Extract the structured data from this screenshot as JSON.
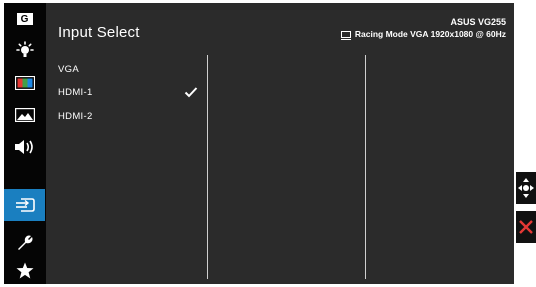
{
  "header": {
    "title": "Input Select",
    "model": "ASUS VG255",
    "mode_info": "Racing Mode VGA 1920x1080 @ 60Hz"
  },
  "sidebar": {
    "items": [
      {
        "icon": "gaming-g-icon"
      },
      {
        "icon": "brightness-icon"
      },
      {
        "icon": "color-icon"
      },
      {
        "icon": "image-icon"
      },
      {
        "icon": "sound-icon"
      },
      {
        "icon": "input-select-icon",
        "active": true
      },
      {
        "icon": "system-setup-icon"
      },
      {
        "icon": "favorite-star-icon"
      }
    ],
    "g_label": "G"
  },
  "options": [
    {
      "label": "VGA",
      "checked": false
    },
    {
      "label": "HDMI-1",
      "checked": true
    },
    {
      "label": "HDMI-2",
      "checked": false
    }
  ],
  "controls": [
    {
      "icon": "navigation-joystick-icon"
    },
    {
      "icon": "close-icon"
    }
  ],
  "colors": {
    "active": "#1a7fc0",
    "close": "#e53935",
    "panel": "#2b2b2b"
  }
}
